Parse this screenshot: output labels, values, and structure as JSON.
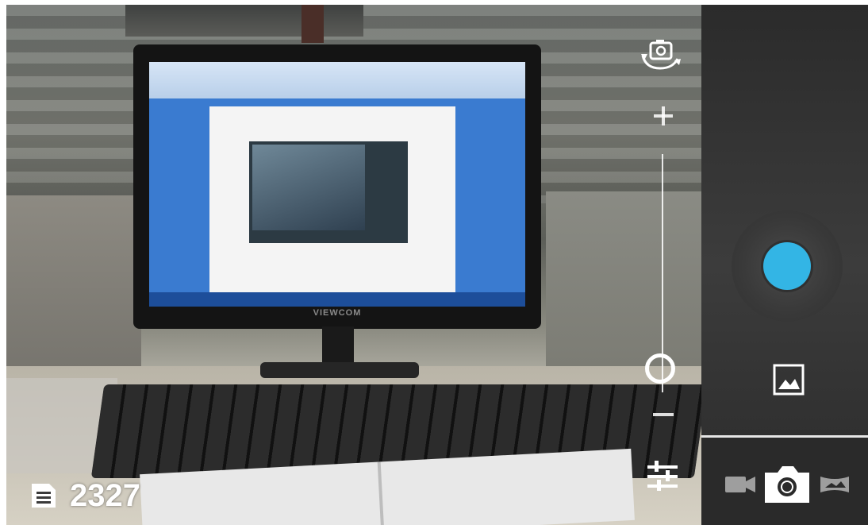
{
  "viewfinder": {
    "monitor_brand": "VIEWCOM"
  },
  "overlay": {
    "switch_camera_icon": "switch-camera-icon",
    "zoom_in_icon": "plus-icon",
    "zoom_out_icon": "minus-icon",
    "zoom_level": 0.1,
    "settings_icon": "sliders-icon",
    "remaining_shots_icon": "document-icon",
    "remaining_shots": "2327"
  },
  "controls": {
    "shutter_icon": "shutter-icon",
    "gallery_icon": "gallery-thumbnail-icon",
    "modes": [
      {
        "name": "video",
        "icon": "video-camera-icon",
        "selected": false
      },
      {
        "name": "photo",
        "icon": "camera-icon",
        "selected": true
      },
      {
        "name": "panorama",
        "icon": "panorama-icon",
        "selected": false
      }
    ]
  },
  "colors": {
    "shutter_accent": "#33b5e5",
    "panel_bg": "#2b2b2b",
    "icon": "#ffffff",
    "icon_dim": "#9e9e9e"
  }
}
